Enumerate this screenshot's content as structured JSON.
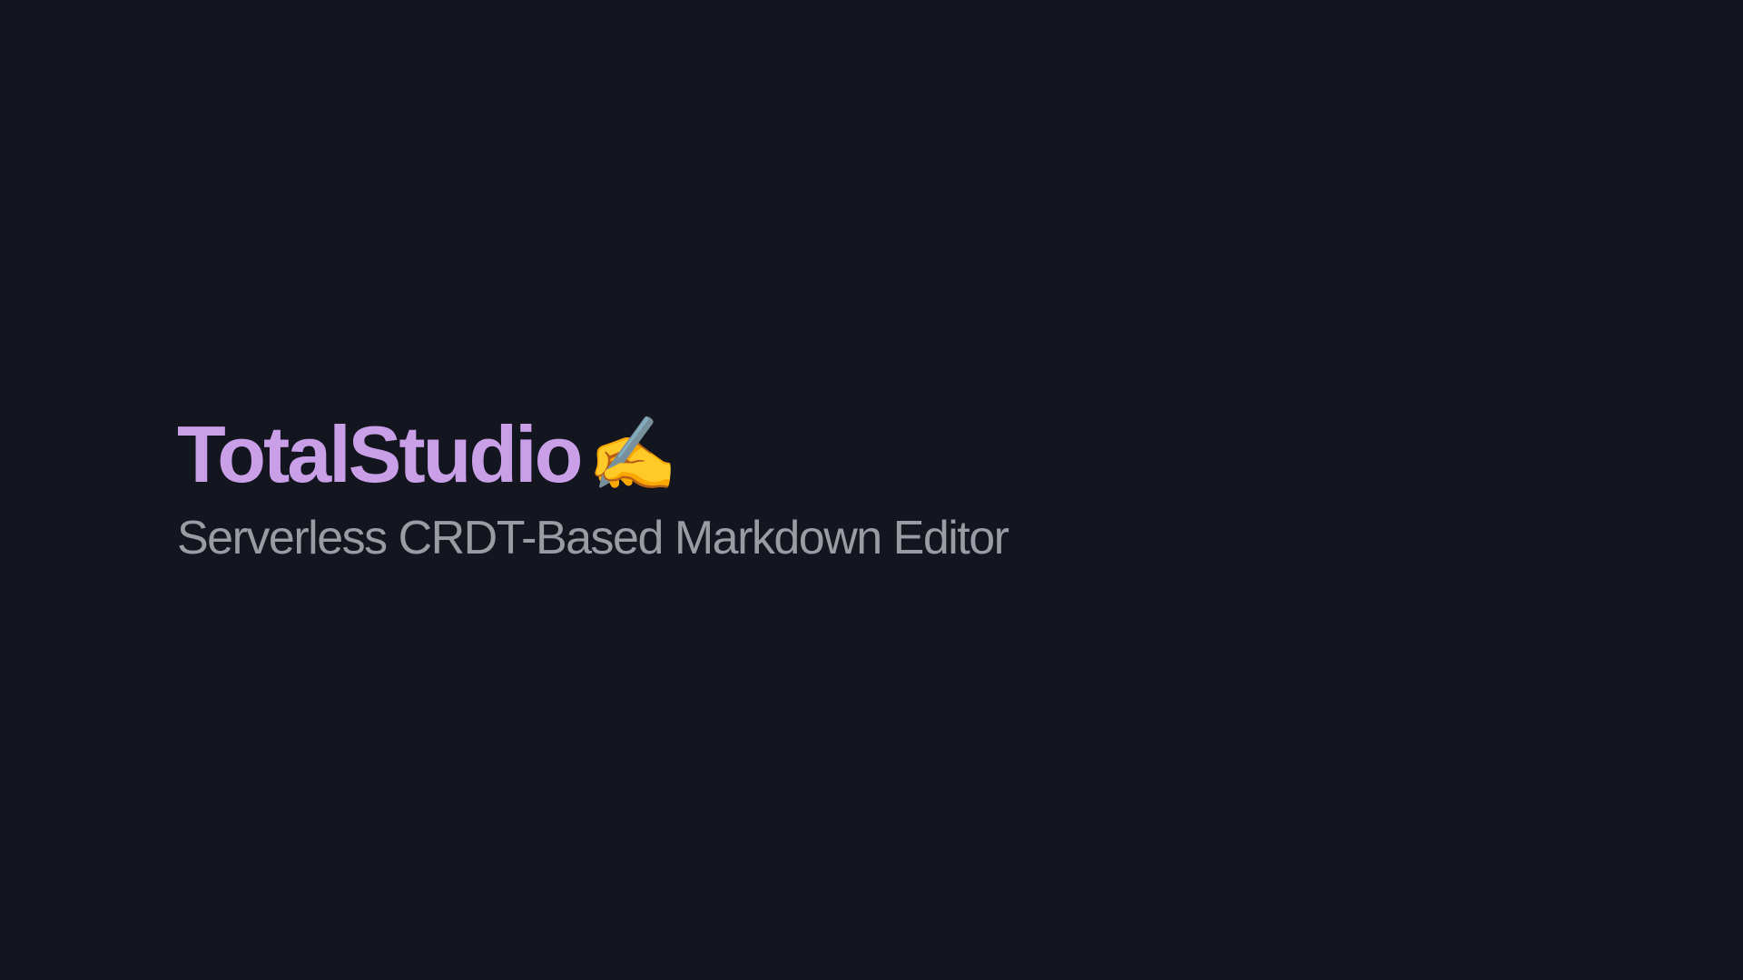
{
  "hero": {
    "title": "TotalStudio",
    "emoji": "✍️",
    "subtitle": "Serverless CRDT-Based Markdown Editor"
  },
  "colors": {
    "background": "#13151f",
    "title": "#c9a0e8",
    "subtitle": "#9a9ca3"
  }
}
